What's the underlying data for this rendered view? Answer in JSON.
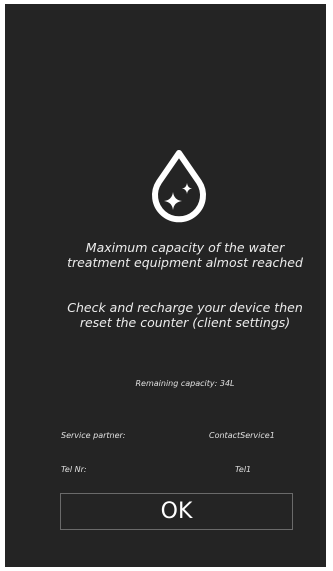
{
  "alert": {
    "icon": "water-drop-sparkle-icon",
    "message_line1": "Maximum capacity of the water treatment equipment almost reached",
    "message_line2": "Check and recharge your device then reset the counter (client settings)",
    "remaining_capacity": "Remaining capacity: 34L",
    "service_partner_label": "Service partner:",
    "service_partner_value": "ContactService1",
    "tel_label": "Tel Nr:",
    "tel_value": "Tel1",
    "ok_label": "OK"
  },
  "colors": {
    "background": "#242424",
    "text": "#ececec",
    "button_border": "#6a6a6a"
  }
}
